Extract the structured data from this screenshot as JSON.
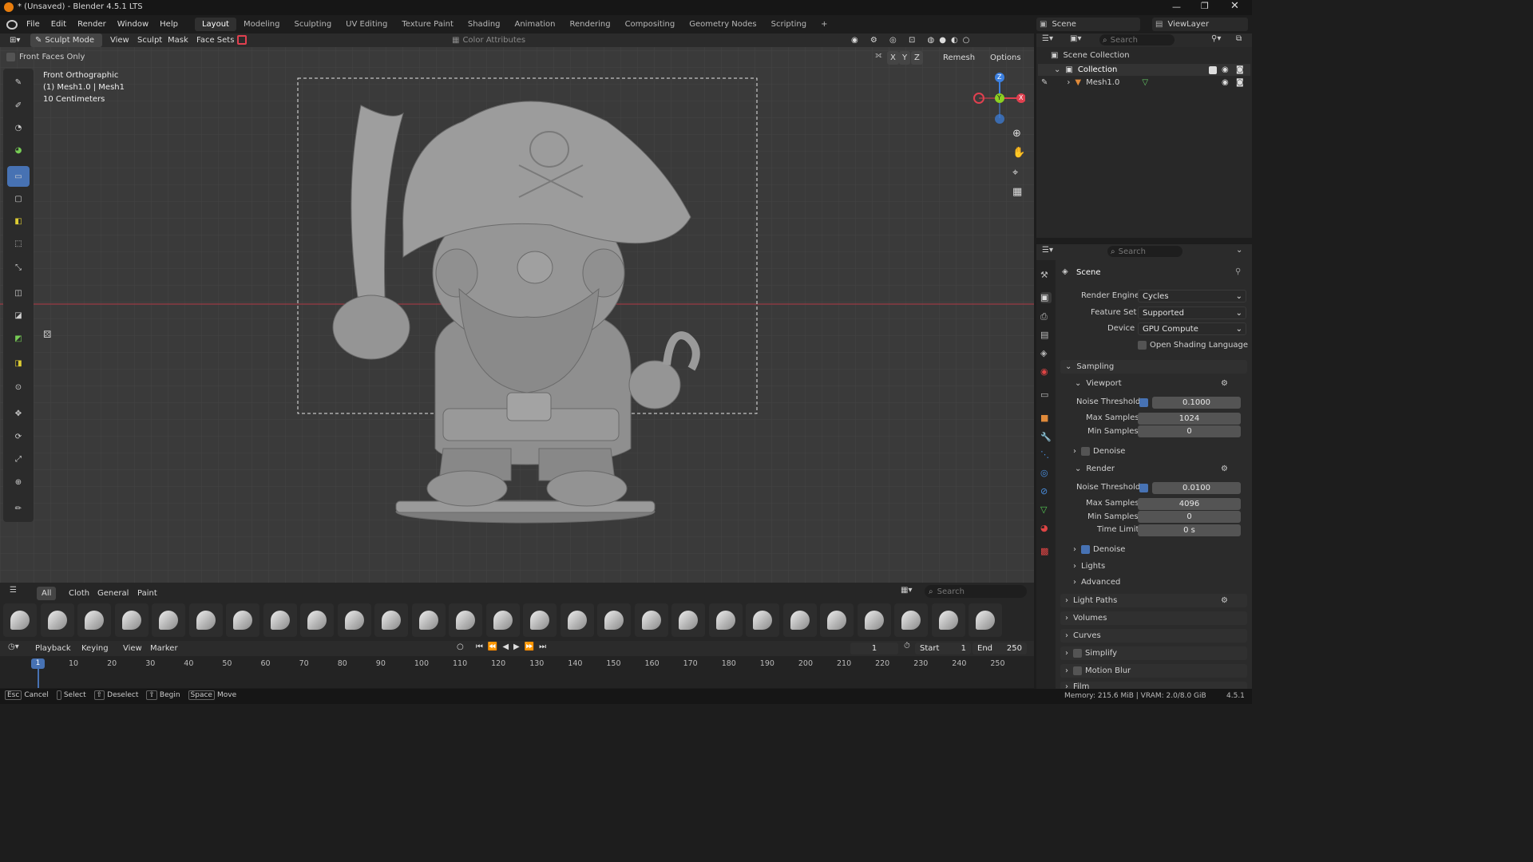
{
  "app": {
    "title": "* (Unsaved) - Blender 4.5.1 LTS"
  },
  "menu": {
    "items": [
      "File",
      "Edit",
      "Render",
      "Window",
      "Help"
    ]
  },
  "workspace_tabs": [
    "Layout",
    "Modeling",
    "Sculpting",
    "UV Editing",
    "Texture Paint",
    "Shading",
    "Animation",
    "Rendering",
    "Compositing",
    "Geometry Nodes",
    "Scripting"
  ],
  "scene_selector": {
    "scene": "Scene",
    "view_layer": "ViewLayer"
  },
  "viewport_header": {
    "mode": "Sculpt Mode",
    "menus": [
      "View",
      "Sculpt",
      "Mask",
      "Face Sets"
    ],
    "color_attributes": "Color Attributes",
    "remesh": "Remesh",
    "options": "Options",
    "axes": [
      "X",
      "Y",
      "Z"
    ],
    "front_faces_only": "Front Faces Only"
  },
  "viewport_overlay": {
    "view_name": "Front Orthographic",
    "object_info": "(1) Mesh1.0 | Mesh1",
    "scale": "10 Centimeters"
  },
  "gizmo": {
    "z": "Z",
    "y": "Y",
    "x": "X"
  },
  "outliner": {
    "search_placeholder": "Search",
    "root": "Scene Collection",
    "collection": "Collection",
    "object": "Mesh1.0"
  },
  "properties": {
    "search_placeholder": "Search",
    "context": "Scene",
    "render_engine_label": "Render Engine",
    "render_engine": "Cycles",
    "feature_set_label": "Feature Set",
    "feature_set": "Supported",
    "device_label": "Device",
    "device": "GPU Compute",
    "osl_label": "Open Shading Language",
    "sampling": "Sampling",
    "viewport": "Viewport",
    "noise_threshold_label": "Noise Threshold",
    "max_samples_label": "Max Samples",
    "min_samples_label": "Min Samples",
    "time_limit_label": "Time Limit",
    "vp_noise_threshold": "0.1000",
    "vp_max_samples": "1024",
    "vp_min_samples": "0",
    "denoise": "Denoise",
    "render": "Render",
    "r_noise_threshold": "0.0100",
    "r_max_samples": "4096",
    "r_min_samples": "0",
    "r_time_limit": "0 s",
    "lights": "Lights",
    "advanced": "Advanced",
    "panels": [
      "Light Paths",
      "Volumes",
      "Curves",
      "Simplify",
      "Motion Blur",
      "Film"
    ]
  },
  "asset_shelf": {
    "tabs": [
      "All",
      "Cloth",
      "General",
      "Paint"
    ],
    "search_placeholder": "Search"
  },
  "timeline": {
    "menus": [
      "Playback",
      "Keying",
      "View",
      "Marker"
    ],
    "current_frame": "1",
    "start_label": "Start",
    "start": "1",
    "end_label": "End",
    "end": "250",
    "ticks": [
      "10",
      "20",
      "30",
      "40",
      "50",
      "60",
      "70",
      "80",
      "90",
      "100",
      "110",
      "120",
      "130",
      "140",
      "150",
      "160",
      "170",
      "180",
      "190",
      "200",
      "210",
      "220",
      "230",
      "240",
      "250"
    ],
    "playhead": "1"
  },
  "status_bar": {
    "hints": [
      {
        "key": "Esc",
        "label": "Cancel"
      },
      {
        "key": "",
        "label": "Select"
      },
      {
        "key": "",
        "label": "Deselect"
      },
      {
        "key": "",
        "label": "Begin"
      },
      {
        "key": "Space",
        "label": "Move"
      }
    ],
    "memory": "Memory: 215.6 MiB | VRAM: 2.0/8.0 GiB",
    "version": "4.5.1"
  },
  "colors": {
    "accent": "#4772b3",
    "axis_x": "#e0404f",
    "axis_y": "#8bd022",
    "axis_z": "#3c80e0",
    "timeline_playhead": "#4772b3"
  }
}
